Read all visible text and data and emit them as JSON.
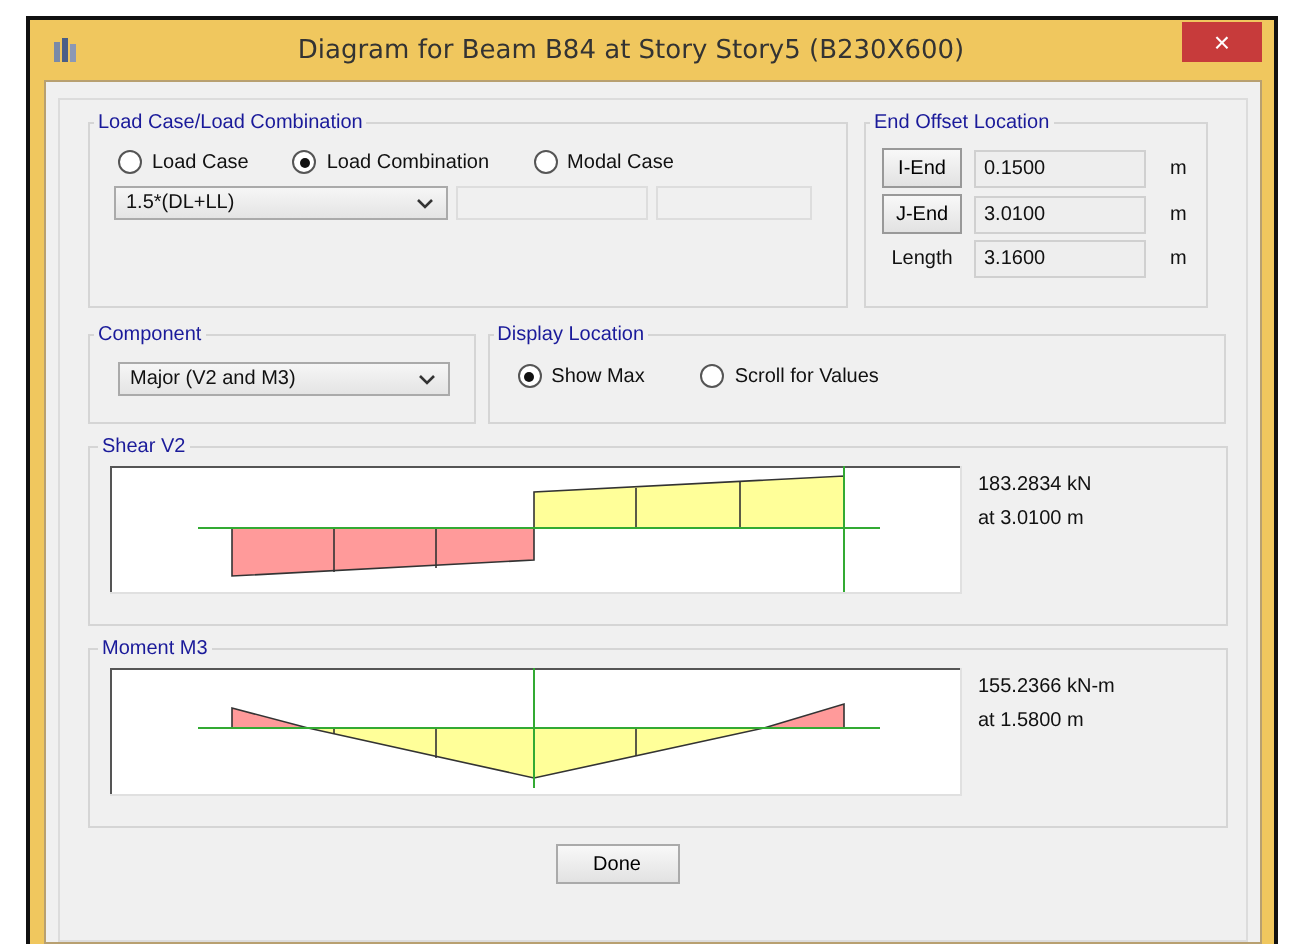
{
  "window": {
    "title": "Diagram for Beam B84 at Story Story5 (B230X600)",
    "close": "×"
  },
  "load_group": {
    "title": "Load Case/Load Combination",
    "options": [
      {
        "label": "Load Case",
        "selected": false
      },
      {
        "label": "Load Combination",
        "selected": true
      },
      {
        "label": "Modal Case",
        "selected": false
      }
    ],
    "combo_value": "1.5*(DL+LL)"
  },
  "end_offset": {
    "title": "End Offset Location",
    "rows": [
      {
        "kind": "button",
        "label": "I-End",
        "value": "0.1500",
        "unit": "m"
      },
      {
        "kind": "button",
        "label": "J-End",
        "value": "3.0100",
        "unit": "m"
      },
      {
        "kind": "label",
        "label": "Length",
        "value": "3.1600",
        "unit": "m"
      }
    ]
  },
  "component": {
    "title": "Component",
    "value": "Major (V2 and M3)"
  },
  "display_location": {
    "title": "Display Location",
    "options": [
      {
        "label": "Show Max",
        "selected": true
      },
      {
        "label": "Scroll for Values",
        "selected": false
      }
    ]
  },
  "diagrams": [
    {
      "kind": "shear",
      "title": "Shear V2",
      "max_value": "183.2834 kN",
      "location": "at 3.0100 m"
    },
    {
      "kind": "moment",
      "title": "Moment M3",
      "max_value": "155.2366 kN-m",
      "location": "at 1.5800 m"
    }
  ],
  "buttons": [
    "Done"
  ]
}
